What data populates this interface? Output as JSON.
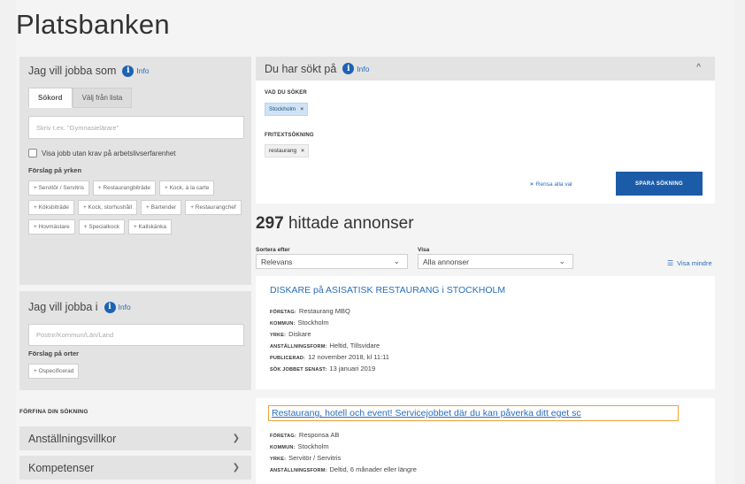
{
  "page_title": "Platsbanken",
  "left": {
    "jobba_som": {
      "heading": "Jag vill jobba som",
      "info_label": "Info",
      "tabs": [
        {
          "label": "Sökord",
          "active": true
        },
        {
          "label": "Välj från lista",
          "active": false
        }
      ],
      "search_placeholder": "Skriv t.ex. \"Gymnasielärare\"",
      "checkbox_label": "Visa jobb utan krav på arbetslivserfarenhet",
      "suggestions_label": "Förslag på yrken",
      "suggestions": [
        "+ Servitör / Servitris",
        "+ Restaurangbiträde",
        "+ Kock, à la carte",
        "+ Köksbiträde",
        "+ Kock, storhushåll",
        "+ Bartender",
        "+ Restaurangchef",
        "+ Hovmästare",
        "+ Specialkock",
        "+ Kallskänka"
      ]
    },
    "jobba_i": {
      "heading": "Jag vill jobba i",
      "info_label": "Info",
      "location_placeholder": "Postnr/Kommun/Län/Land",
      "suggestions_label": "Förslag på orter",
      "suggestions": [
        "+ Ospecificerad"
      ]
    },
    "refine_label": "FÖRFINA DIN SÖKNING",
    "accordions": [
      "Anställningsvillkor",
      "Kompetenser"
    ]
  },
  "search_summary": {
    "heading": "Du har sökt på",
    "info_label": "Info",
    "what_label": "VAD DU SÖKER",
    "what_tags": [
      "Stockholm"
    ],
    "freetext_label": "FRITEXTSÖKNING",
    "freetext_tags": [
      "restaurang"
    ],
    "clear_label": "Rensa alla val",
    "save_label": "SPARA SÖKNING"
  },
  "results": {
    "count": "297",
    "count_suffix": "hittade annonser",
    "sort_label": "Sortera efter",
    "sort_value": "Relevans",
    "show_label": "Visa",
    "show_value": "Alla annonser",
    "visa_mindre": "Visa mindre"
  },
  "listings": [
    {
      "title": "DISKARE på ASISATISK RESTAURANG i STOCKHOLM",
      "company": {
        "key": "FÖRETAG:",
        "value": "Restaurang MBQ"
      },
      "municipality": {
        "key": "KOMMUN:",
        "value": "Stockholm"
      },
      "profession": {
        "key": "YRKE:",
        "value": "Diskare"
      },
      "employment": {
        "key": "ANSTÄLLNINGSFORM:",
        "value": "Heltid, Tillsvidare"
      },
      "published": {
        "key": "PUBLICERAD:",
        "value": "12 november 2018, kl 11:11"
      },
      "apply_by": {
        "key": "SÖK JOBBET SENAST:",
        "value": "13 januari 2019"
      }
    },
    {
      "title": "Restaurang, hotell och event! Servicejobbet där du kan påverka ditt eget sc",
      "company": {
        "key": "FÖRETAG:",
        "value": "Responsa AB"
      },
      "municipality": {
        "key": "KOMMUN:",
        "value": "Stockholm"
      },
      "profession": {
        "key": "YRKE:",
        "value": "Servitör / Servitris"
      },
      "employment": {
        "key": "ANSTÄLLNINGSFORM:",
        "value": "Deltid, 6 månader eller längre"
      }
    }
  ],
  "colors": {
    "accent_blue": "#1c5ba8",
    "link_blue": "#2a6ebb",
    "panel_grey": "#e3e3e3",
    "focus_orange": "#e9a23b",
    "tag_blue": "#cfe3f5"
  },
  "icons": {
    "info": "info-circle-icon",
    "chevron": "chevron-down-icon",
    "caret_up": "chevron-up-icon",
    "remove": "close-icon",
    "list": "list-icon"
  }
}
